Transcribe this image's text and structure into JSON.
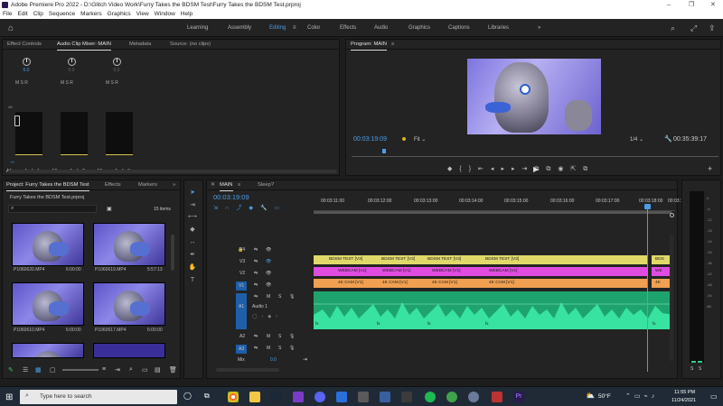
{
  "window": {
    "title": "Adobe Premiere Pro 2022 - D:\\Glitch Video Work\\Furry Takes the BDSM Test\\Furry Takes the BDSM Test.prproj"
  },
  "menu": [
    "File",
    "Edit",
    "Clip",
    "Sequence",
    "Markers",
    "Graphics",
    "View",
    "Window",
    "Help"
  ],
  "workspaces": [
    "Learning",
    "Assembly",
    "Editing",
    "Color",
    "Effects",
    "Audio",
    "Graphics",
    "Captions",
    "Libraries"
  ],
  "source_panel": {
    "tabs": [
      "Effect Controls",
      "Audio Clip Mixer: MAIN",
      "Metadata",
      "Source: (no clips)"
    ],
    "channels": [
      {
        "track": "A1",
        "name": "Audio 1",
        "value": "0.0"
      },
      {
        "track": "A2",
        "name": "Audio 2",
        "value": "0.0"
      },
      {
        "track": "A3",
        "name": "Audio 3",
        "value": "0.0"
      }
    ],
    "db_labels": [
      "dB",
      "6",
      "0",
      "-6",
      "-12",
      "-18",
      "-24",
      "-30",
      "-36",
      "-42",
      "-48",
      "-54",
      "-60"
    ],
    "msr": "M S R",
    "neg_inf": "-∞",
    "meter_pan": "L      R"
  },
  "program": {
    "title": "Program: MAIN",
    "timecode": "00:03:19:09",
    "fit": "Fit",
    "quality": "1/4",
    "duration": "00:35:39:17"
  },
  "project": {
    "tabs": [
      "Project: Furry Takes the BDSM Test",
      "Effects",
      "Markers"
    ],
    "file": "Furry Takes the BDSM Test.prproj",
    "count": "15 items",
    "items": [
      {
        "name": "P1060620.MP4",
        "dur": "6:00:00"
      },
      {
        "name": "P1060619.MP4",
        "dur": "5:57:13"
      },
      {
        "name": "P1060610.MP4",
        "dur": "6:00:00"
      },
      {
        "name": "P1060617.MP4",
        "dur": "6:00:00"
      }
    ]
  },
  "timeline": {
    "tabs": [
      "MAIN",
      "Sleep?"
    ],
    "timecode": "00:03:19:09",
    "ruler": [
      "00:03:11:00",
      "00:03:12:00",
      "00:03:13:00",
      "00:03:14:00",
      "00:03:15:00",
      "00:03:16:00",
      "00:03:17:00",
      "00:03:18:00",
      "00:03:19:00",
      "00:0"
    ],
    "tracks": {
      "v4": "V4",
      "v3": "V3",
      "v2": "V2",
      "v1": "V1",
      "a1": "A1",
      "a2": "A2",
      "a3": "A3",
      "audio1": "Audio 1",
      "mix": "Mix",
      "mix_val": "0.0",
      "v3_label": "V3",
      "v3_src": "V3"
    },
    "clips_v3": [
      "BDSM TEST [V3]",
      "BDSM TEST [V3]",
      "BDSM TEST [V3]",
      "BDSM TEST [V3]",
      "BDS"
    ],
    "clips_v2": [
      "WEBCAM [V1]",
      "WEBCAM [V1]",
      "WEBCAM [V1]",
      "WEBCAM [V1]",
      "WE"
    ],
    "clips_v1": [
      "4K CAM [V1]",
      "4K CAM [V1]",
      "4K CAM [V1]",
      "4K CAM [V1]",
      "4K"
    ],
    "audio_fx": [
      "fx",
      "fx",
      "fx",
      "fx",
      "fx"
    ],
    "meter_btns": [
      "S",
      "S"
    ]
  },
  "taskbar": {
    "search": "Type here to search",
    "weather": "50°F",
    "time": "11:55 PM",
    "date": "11/24/2021"
  },
  "colors": {
    "accent": "#4c9de8",
    "v3_clip": "#e0d96a",
    "v2_clip": "#e04ce0",
    "v1_clip": "#f0a050",
    "audio_clip": "#2fcf8f",
    "playhead": "#4c9de8"
  }
}
